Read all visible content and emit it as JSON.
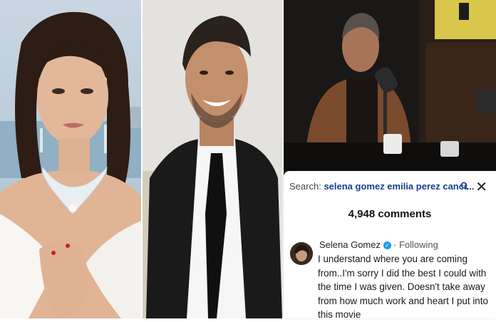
{
  "photos": [
    {
      "subject": "woman-portrait",
      "background": "sky-and-sea"
    },
    {
      "subject": "man-smiling-suit",
      "background": "light-grey"
    },
    {
      "subject": "man-at-podcast-microphone",
      "background": "dark-studio"
    }
  ],
  "comments_panel": {
    "search_label": "Search:",
    "search_query": "selena gomez emilia perez canci...",
    "search_icon": "search-icon",
    "close_icon": "close-icon",
    "count_text": "4,948 comments",
    "comment": {
      "username": "Selena Gomez",
      "verified_icon": "verified-badge-icon",
      "following_label": "Following",
      "text": "I understand where you are coming from..I'm sorry I did the best I could with the time I was given. Doesn't take away from how much work and heart I put into this movie"
    }
  },
  "colors": {
    "link_blue": "#1a3d8f",
    "verified_blue": "#1d9bf0"
  }
}
